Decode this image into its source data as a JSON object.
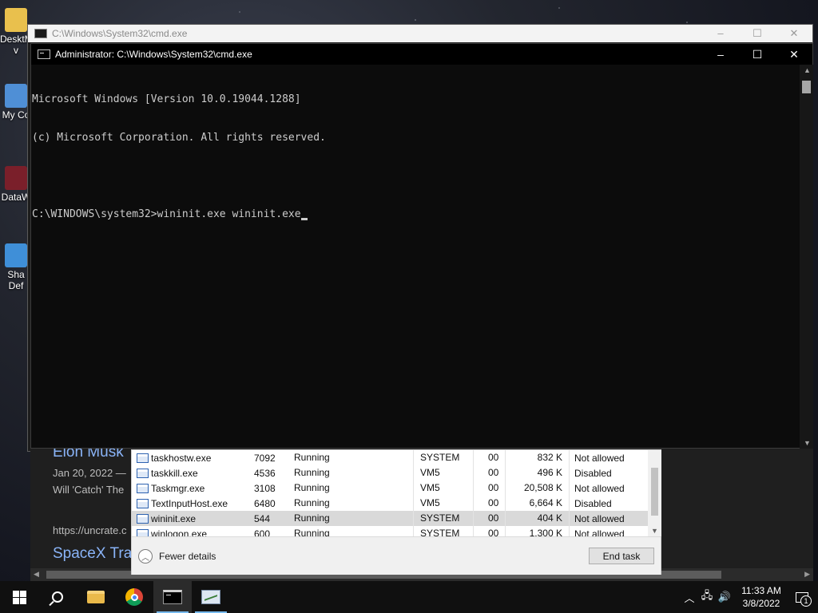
{
  "desktop": {
    "icons": [
      {
        "label": "DesktM\nv",
        "icon": "folder-icon"
      },
      {
        "label": "My Co",
        "icon": "computer-icon"
      },
      {
        "label": "DataW",
        "icon": "app-shortcut-icon"
      },
      {
        "label": "Sha\nDef",
        "icon": "shield-shortcut-icon"
      }
    ]
  },
  "cmd_back": {
    "title": "C:\\Windows\\System32\\cmd.exe",
    "minimize": "–",
    "maximize": "☐",
    "close": "✕"
  },
  "cmd_front": {
    "title": "Administrator: C:\\Windows\\System32\\cmd.exe",
    "minimize": "–",
    "maximize": "☐",
    "close": "✕",
    "lines": [
      "Microsoft Windows [Version 10.0.19044.1288]",
      "(c) Microsoft Corporation. All rights reserved.",
      "",
      "C:\\WINDOWS\\system32>wininit.exe wininit.exe"
    ]
  },
  "browser_bg": {
    "article1_title": "Elon Musk",
    "article1_date": "Jan 20, 2022 —",
    "article1_snippet": "Will 'Catch' The",
    "article_url": "https://uncrate.c",
    "article2_title": "SpaceX Tra"
  },
  "task_manager": {
    "rows": [
      {
        "name": "taskhostw.exe",
        "pid": "7092",
        "status": "Running",
        "user": "SYSTEM",
        "cpu": "00",
        "memory": "832 K",
        "uac": "Not allowed",
        "selected": false
      },
      {
        "name": "taskkill.exe",
        "pid": "4536",
        "status": "Running",
        "user": "VM5",
        "cpu": "00",
        "memory": "496 K",
        "uac": "Disabled",
        "selected": false
      },
      {
        "name": "Taskmgr.exe",
        "pid": "3108",
        "status": "Running",
        "user": "VM5",
        "cpu": "00",
        "memory": "20,508 K",
        "uac": "Not allowed",
        "selected": false
      },
      {
        "name": "TextInputHost.exe",
        "pid": "6480",
        "status": "Running",
        "user": "VM5",
        "cpu": "00",
        "memory": "6,664 K",
        "uac": "Disabled",
        "selected": false
      },
      {
        "name": "wininit.exe",
        "pid": "544",
        "status": "Running",
        "user": "SYSTEM",
        "cpu": "00",
        "memory": "404 K",
        "uac": "Not allowed",
        "selected": true
      },
      {
        "name": "winlogon.exe",
        "pid": "600",
        "status": "Running",
        "user": "SYSTEM",
        "cpu": "00",
        "memory": "1,300 K",
        "uac": "Not allowed",
        "selected": false
      }
    ],
    "fewer_details": "Fewer details",
    "end_task": "End task"
  },
  "taskbar": {
    "apps": [
      "start-button",
      "search-button",
      "file-explorer",
      "chrome",
      "command-prompt",
      "task-manager"
    ],
    "time": "11:33 AM",
    "date": "3/8/2022",
    "notification_count": "1"
  }
}
